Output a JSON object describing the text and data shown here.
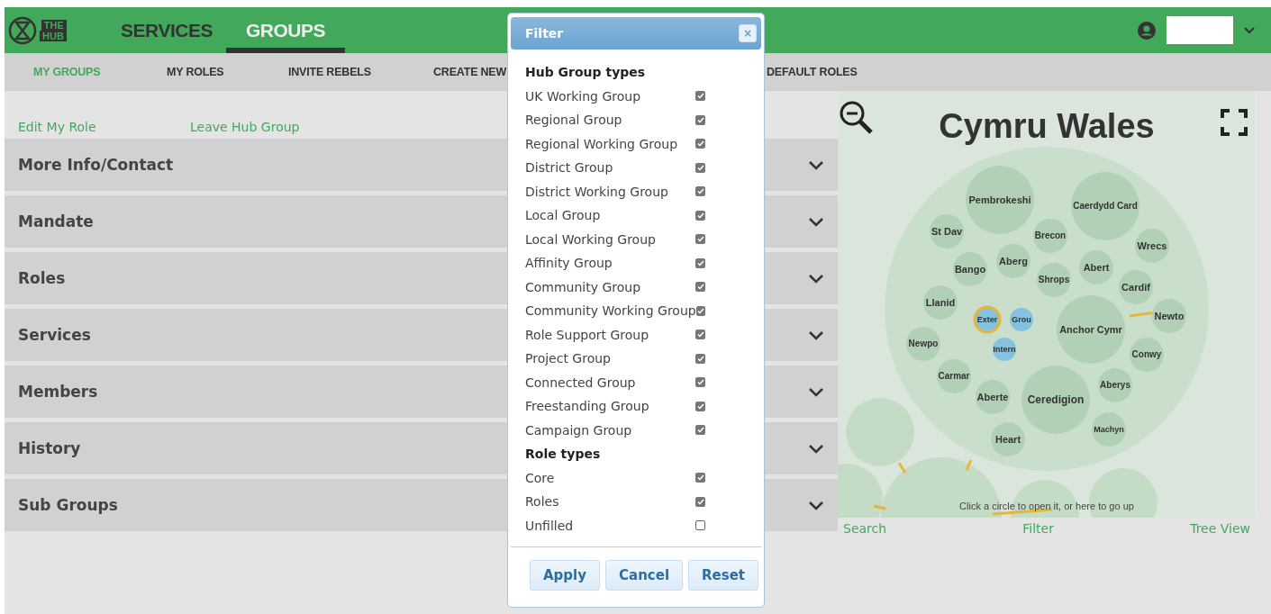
{
  "header": {
    "logo": [
      "THE",
      "HUB"
    ],
    "tabs": [
      {
        "label": "SERVICES",
        "selected": false
      },
      {
        "label": "GROUPS",
        "selected": true
      }
    ]
  },
  "subnav": [
    {
      "label": "MY GROUPS",
      "selected": true
    },
    {
      "label": "MY ROLES",
      "selected": false
    },
    {
      "label": "INVITE REBELS",
      "selected": false
    },
    {
      "label": "CREATE NEW",
      "selected": false
    },
    {
      "label": "DEFAULT ROLES",
      "selected": false
    }
  ],
  "actions": [
    "Edit My Role",
    "Leave Hub Group"
  ],
  "sections": [
    {
      "title": "More Info/Contact",
      "expanded": false
    },
    {
      "title": "Mandate",
      "expanded": false
    },
    {
      "title": "Roles",
      "expanded": false
    },
    {
      "title": "Services",
      "expanded": false
    },
    {
      "title": "Members",
      "expanded": false
    },
    {
      "title": "History",
      "expanded": false
    },
    {
      "title": "Sub Groups",
      "expanded": false
    }
  ],
  "map": {
    "title": "Cymru Wales",
    "hint": "Click a circle to open it, or here to go up",
    "circles": [
      {
        "label": "Pembrokeshi",
        "kind": "group",
        "selected": false
      },
      {
        "label": "Caerdydd Card",
        "kind": "group",
        "selected": false
      },
      {
        "label": "St Dav",
        "kind": "group",
        "selected": false
      },
      {
        "label": "Brecon",
        "kind": "group",
        "selected": false
      },
      {
        "label": "Wrecs",
        "kind": "group",
        "selected": false
      },
      {
        "label": "Bango",
        "kind": "group",
        "selected": false
      },
      {
        "label": "Aberg",
        "kind": "group",
        "selected": false
      },
      {
        "label": "Shrops",
        "kind": "group",
        "selected": false
      },
      {
        "label": "Abert",
        "kind": "group",
        "selected": false
      },
      {
        "label": "Cardif",
        "kind": "group",
        "selected": false
      },
      {
        "label": "Llanid",
        "kind": "group",
        "selected": false
      },
      {
        "label": "Exter",
        "kind": "role",
        "selected": true
      },
      {
        "label": "Grou",
        "kind": "role",
        "selected": false
      },
      {
        "label": "Anchor Cymr",
        "kind": "group",
        "selected": false
      },
      {
        "label": "Newto",
        "kind": "group",
        "selected": false
      },
      {
        "label": "Newpo",
        "kind": "group",
        "selected": false
      },
      {
        "label": "Intern",
        "kind": "role",
        "selected": false
      },
      {
        "label": "Conwy",
        "kind": "group",
        "selected": false
      },
      {
        "label": "Carmar",
        "kind": "group",
        "selected": false
      },
      {
        "label": "Aberte",
        "kind": "group",
        "selected": false
      },
      {
        "label": "Ceredigion",
        "kind": "group",
        "selected": false
      },
      {
        "label": "Aberys",
        "kind": "group",
        "selected": false
      },
      {
        "label": "Machyn",
        "kind": "group",
        "selected": false
      },
      {
        "label": "Heart",
        "kind": "group",
        "selected": false
      }
    ],
    "links": [
      "Search",
      "Filter",
      "Tree View"
    ]
  },
  "filter": {
    "title": "Filter",
    "close": "×",
    "groups": [
      {
        "heading": "Hub Group types",
        "options": [
          {
            "label": "UK Working Group",
            "checked": true
          },
          {
            "label": "Regional Group",
            "checked": true
          },
          {
            "label": "Regional Working Group",
            "checked": true
          },
          {
            "label": "District Group",
            "checked": true
          },
          {
            "label": "District Working Group",
            "checked": true
          },
          {
            "label": "Local Group",
            "checked": true
          },
          {
            "label": "Local Working Group",
            "checked": true
          },
          {
            "label": "Affinity Group",
            "checked": true
          },
          {
            "label": "Community Group",
            "checked": true
          },
          {
            "label": "Community Working Group",
            "checked": true
          },
          {
            "label": "Role Support Group",
            "checked": true
          },
          {
            "label": "Project Group",
            "checked": true
          },
          {
            "label": "Connected Group",
            "checked": true
          },
          {
            "label": "Freestanding Group",
            "checked": true
          },
          {
            "label": "Campaign Group",
            "checked": true
          }
        ]
      },
      {
        "heading": "Role types",
        "options": [
          {
            "label": "Core",
            "checked": true
          },
          {
            "label": "Roles",
            "checked": true
          },
          {
            "label": "Unfilled",
            "checked": false
          }
        ]
      }
    ],
    "buttons": [
      "Apply",
      "Cancel",
      "Reset"
    ]
  }
}
